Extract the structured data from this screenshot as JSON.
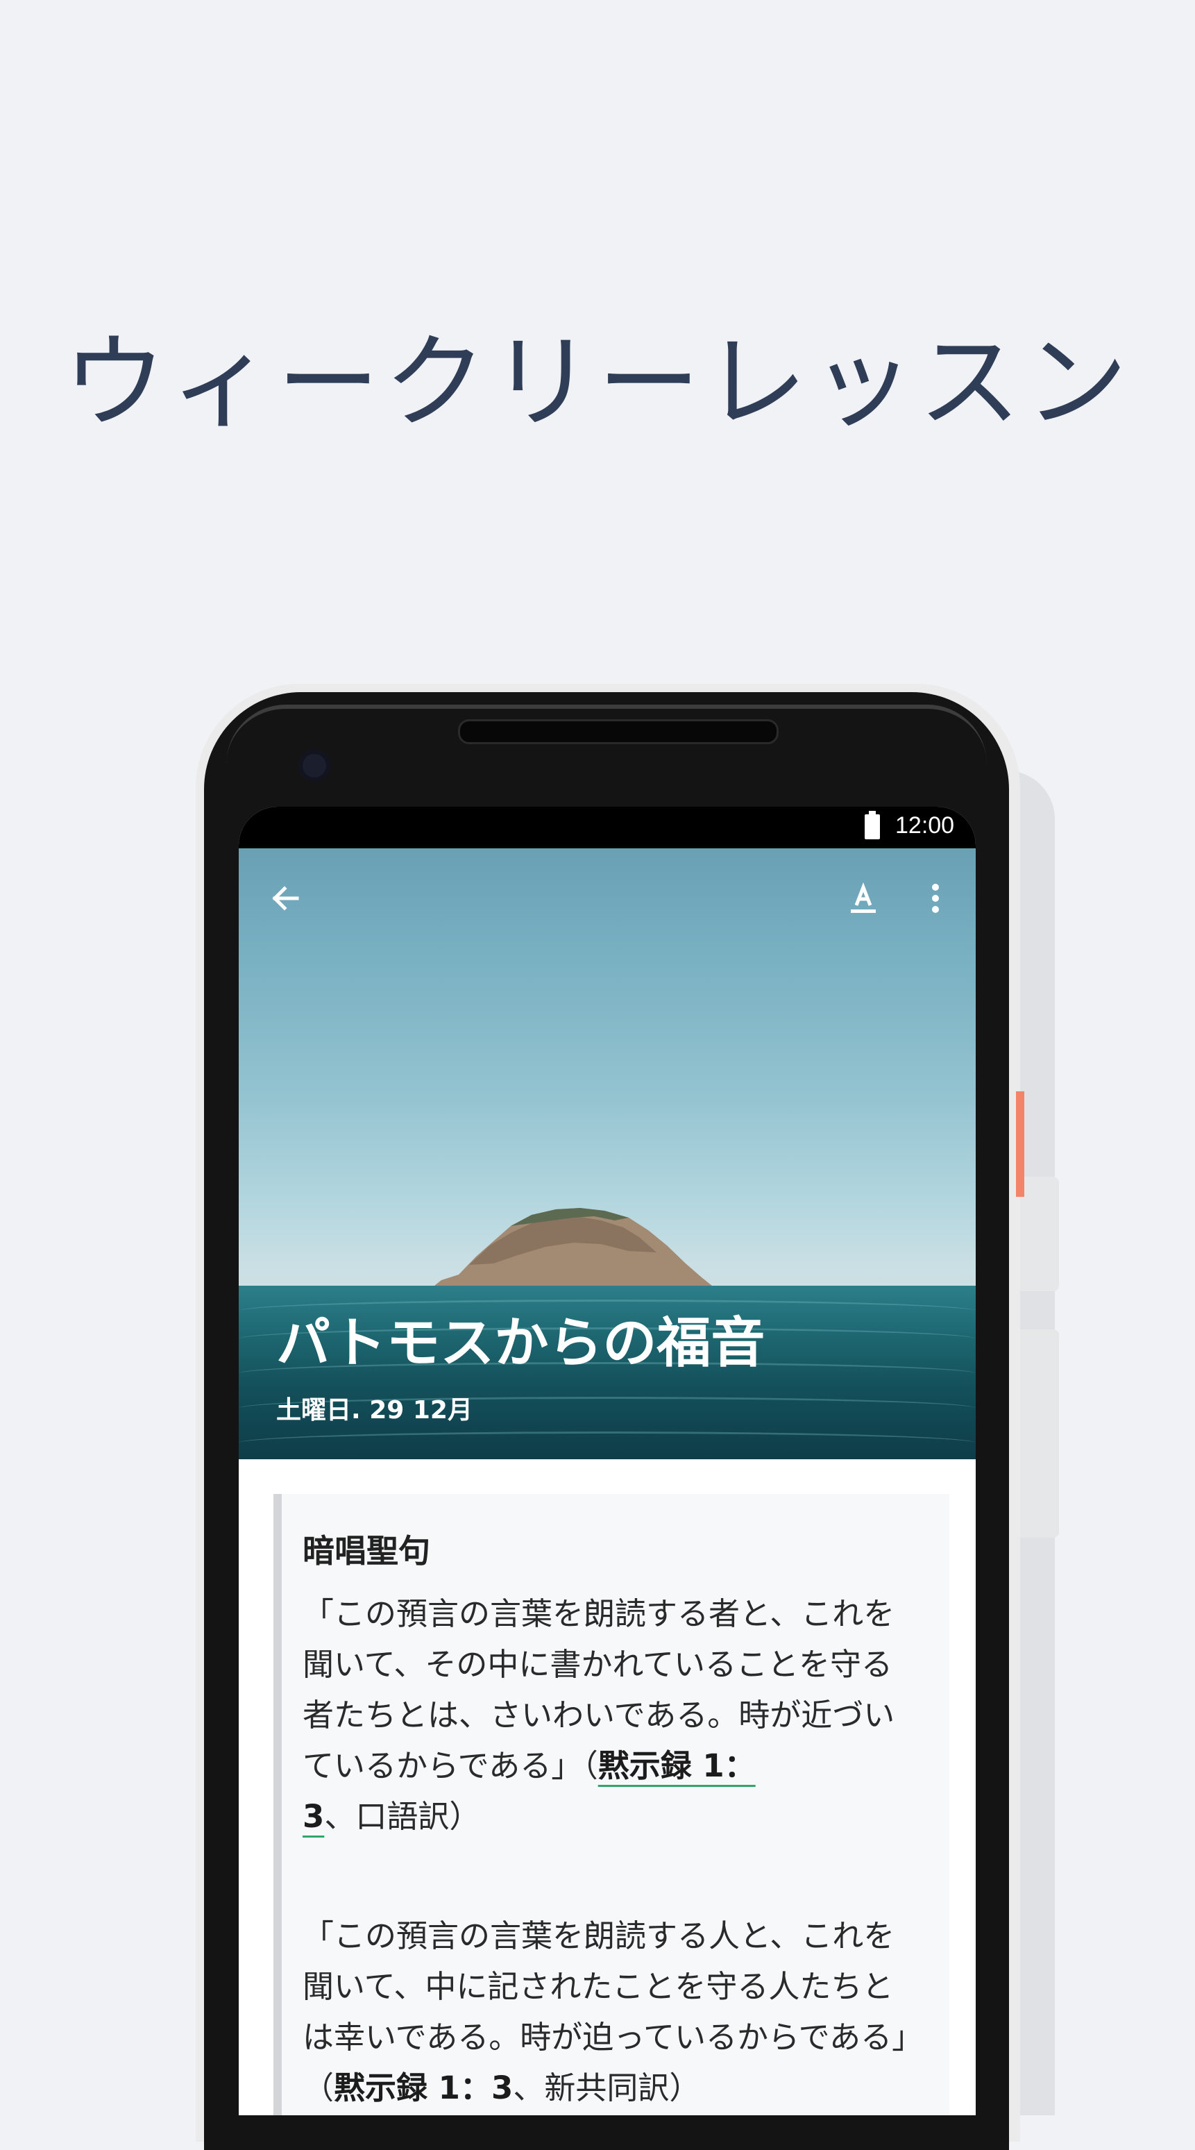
{
  "headline": "ウィークリーレッスン",
  "status_bar": {
    "time": "12:00",
    "battery_icon": "battery-full-icon"
  },
  "toolbar": {
    "back_icon": "arrow-left-icon",
    "font_icon": "text-format-icon",
    "more_icon": "more-vertical-icon"
  },
  "lesson": {
    "title": "パトモスからの福音",
    "date": "土曜日. 29 12月"
  },
  "memory_text": {
    "heading": "暗唱聖句",
    "verse1_text": "「この預言の言葉を朗読する者と、これを聞いて、その中に書かれていることを守る者たちとは、さいわいである。時が近づいているからである」（",
    "verse1_ref": "黙示録 1：3",
    "verse1_suffix": "、口語訳）",
    "verse2_text": "「この預言の言葉を朗読する人と、これを聞いて、中に記されたことを守る人たちとは幸いである。時が迫っているからである」（",
    "verse2_ref": "黙示録 1：3",
    "verse2_suffix": "、新共同訳）"
  },
  "colors": {
    "page_background": "#f0f2f5",
    "headline": "#2f3d57",
    "phone_body": "#141414",
    "power_button_accent": "#f3846a",
    "reference_underline": "#2fa66a"
  }
}
